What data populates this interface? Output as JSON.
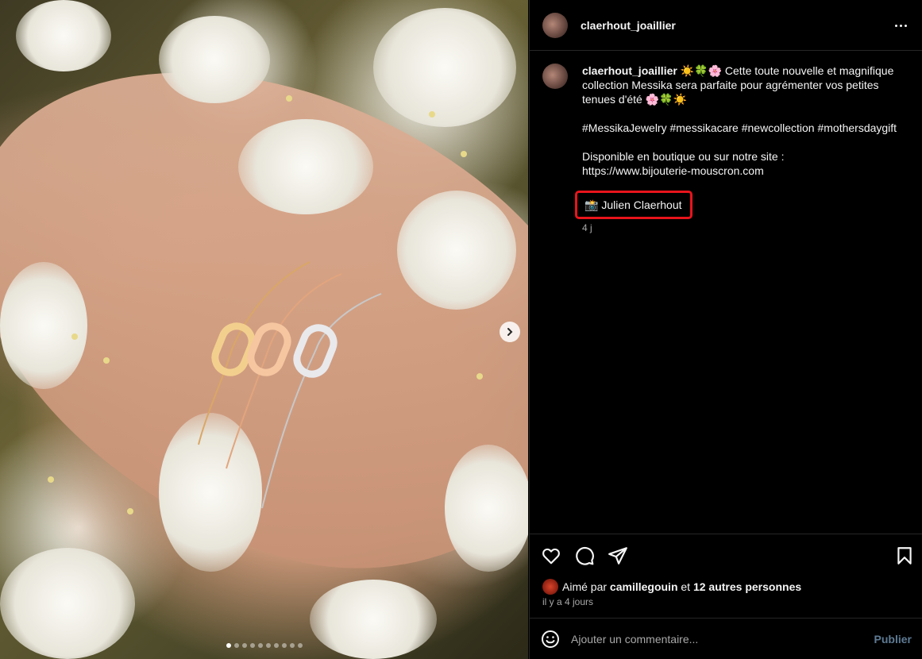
{
  "post": {
    "username": "claerhout_joaillier",
    "caption": {
      "author": "claerhout_joaillier",
      "intro": " ☀️🍀🌸 Cette toute nouvelle et magnifique collection Messika sera parfaite pour agrémenter vos petites tenues d'été 🌸🍀☀️",
      "hashtags": "#MessikaJewelry #messikacare #newcollection #mothersdaygift",
      "availability": "Disponible en boutique ou sur notre site :\nhttps://www.bijouterie-mouscron.com",
      "credit": "📸 Julien Claerhout",
      "age": "4 j"
    },
    "likes": {
      "prefix": "Aimé par ",
      "user": "camillegouin",
      "mid": " et ",
      "others": "12 autres personnes"
    },
    "date": "il y a 4 jours",
    "comment_placeholder": "Ajouter un commentaire...",
    "publish_label": "Publier",
    "carousel": {
      "total": 10,
      "current": 1
    }
  },
  "icons": {
    "more": "more-options-icon",
    "like": "heart-icon",
    "comment": "comment-icon",
    "share": "send-icon",
    "save": "bookmark-icon",
    "emoji": "emoji-icon",
    "next": "chevron-right-icon"
  },
  "colors": {
    "background": "#000000",
    "text": "#f5f5f5",
    "muted": "#a8a8a8",
    "divider": "#262626",
    "highlight": "#e8141b",
    "publish": "#5e7b94"
  }
}
